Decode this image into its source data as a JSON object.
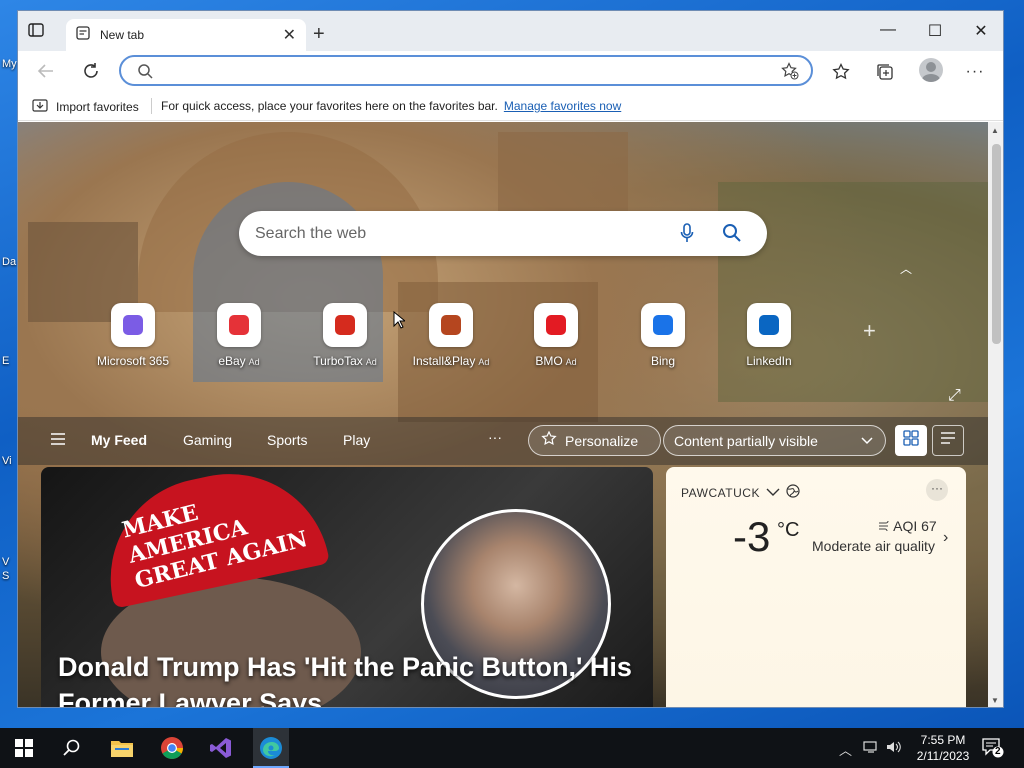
{
  "desktop": {
    "labels": [
      "My",
      "Da",
      "E",
      "Vi",
      "V S"
    ]
  },
  "browser": {
    "tab": {
      "title": "New tab"
    },
    "address": {
      "value": "",
      "placeholder": ""
    },
    "favorites_bar": {
      "import_label": "Import favorites",
      "message": "For quick access, place your favorites here on the favorites bar.",
      "manage_link": "Manage favorites now"
    }
  },
  "newtab": {
    "search": {
      "placeholder": "Search the web"
    },
    "quick_links": [
      {
        "label": "Microsoft 365",
        "ad": "",
        "icon": "microsoft365-icon",
        "color": "#7b5ce5"
      },
      {
        "label": "eBay",
        "ad": "Ad",
        "icon": "ebay-icon",
        "color": "#e53238"
      },
      {
        "label": "TurboTax",
        "ad": "Ad",
        "icon": "turbotax-icon",
        "color": "#d52b1e"
      },
      {
        "label": "Install&Play",
        "ad": "Ad",
        "icon": "installplay-icon",
        "color": "#b5461f"
      },
      {
        "label": "BMO",
        "ad": "Ad",
        "icon": "bmo-icon",
        "color": "#e31b23"
      },
      {
        "label": "Bing",
        "ad": "",
        "icon": "bing-icon",
        "color": "#1a73e8"
      },
      {
        "label": "LinkedIn",
        "ad": "",
        "icon": "linkedin-icon",
        "color": "#0a66c2"
      }
    ],
    "feed": {
      "tabs": [
        "My Feed",
        "Gaming",
        "Sports",
        "Play"
      ],
      "more": "···",
      "personalize_label": "Personalize",
      "content_visibility": "Content partially visible"
    },
    "hero": {
      "cap_text": "MAKE AMERICA GREAT AGAIN",
      "headline": "Donald Trump Has 'Hit the Panic Button,' His Former Lawyer Says"
    },
    "weather": {
      "location": "PAWCATUCK",
      "temperature": "-3",
      "unit": "°C",
      "aqi": "AQI 67",
      "quality": "Moderate air quality"
    }
  },
  "taskbar": {
    "time": "7:55 PM",
    "date": "2/11/2023",
    "notifications": "2"
  },
  "colors": {
    "accent": "#5b8fd8",
    "link": "#1a5fb4",
    "taskbar": "#0f1216"
  }
}
